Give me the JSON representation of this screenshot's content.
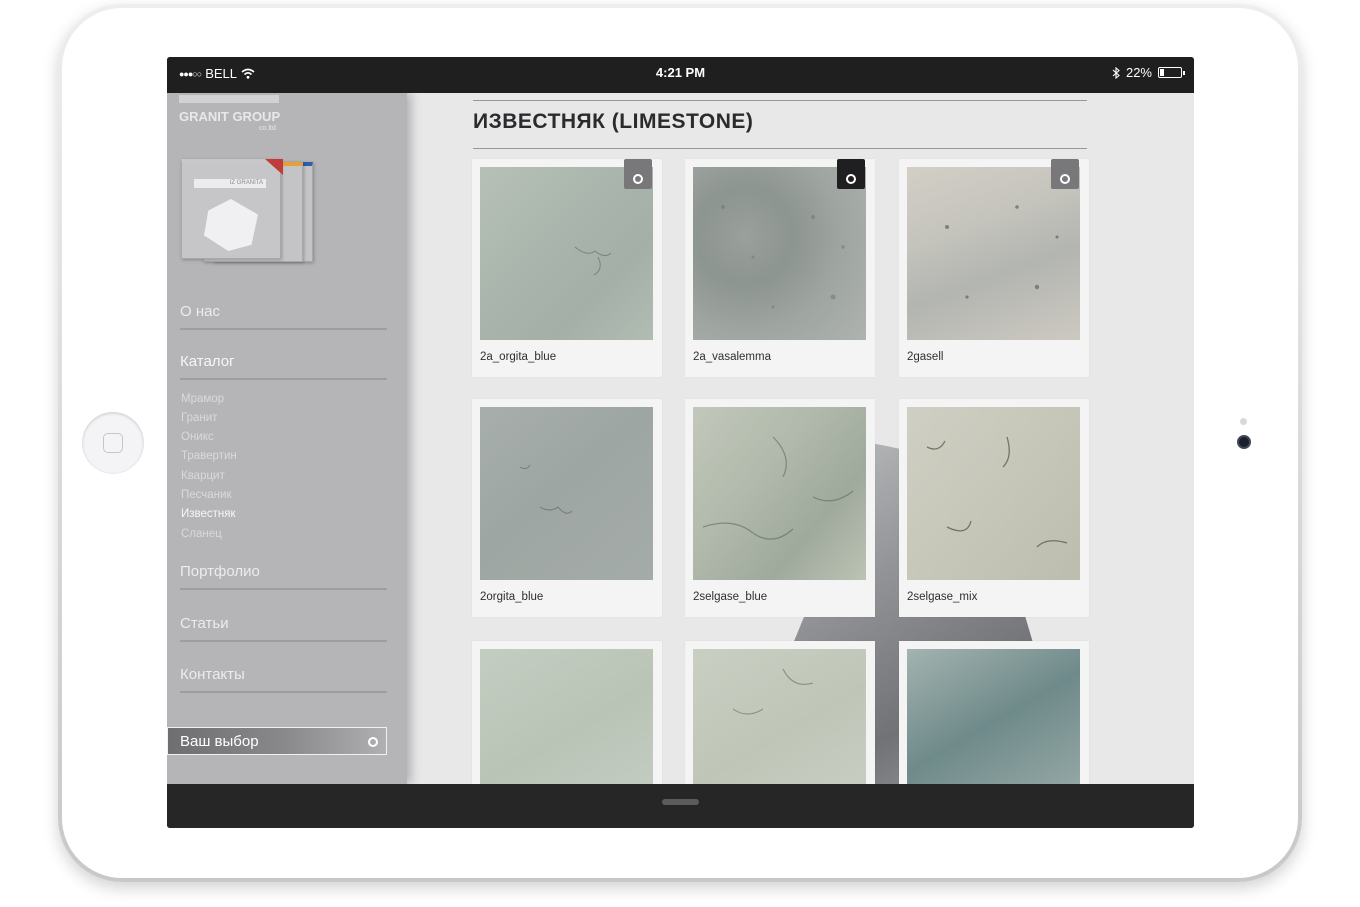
{
  "status_bar": {
    "signal": "●●●○○",
    "carrier": "BELL",
    "wifi_icon": "wifi-icon",
    "time": "4:21 PM",
    "bluetooth_icon": "bluetooth-icon",
    "battery": "22%",
    "battery_level": 0.22
  },
  "logo": {
    "name": "GRANIT GROUP",
    "suffix": "co.ltd"
  },
  "catalog_book": {
    "band_text": "IZ GRANITA"
  },
  "sidebar": {
    "nav": [
      {
        "label": "О нас"
      },
      {
        "label": "Каталог"
      },
      {
        "label": "Портфолио"
      },
      {
        "label": "Статьи"
      },
      {
        "label": "Контакты"
      }
    ],
    "sub_items": [
      {
        "label": "Мрамор"
      },
      {
        "label": "Гранит"
      },
      {
        "label": "Оникс"
      },
      {
        "label": "Травертин"
      },
      {
        "label": "Кварцит"
      },
      {
        "label": "Песчаник"
      },
      {
        "label": "Известняк"
      },
      {
        "label": "Сланец"
      }
    ],
    "choice_label": "Ваш выбор"
  },
  "page": {
    "title": "ИЗВЕСТНЯК (LIMESTONE)"
  },
  "products": [
    {
      "name": "2a_orgita_blue",
      "pick_icon": "select-circle-icon"
    },
    {
      "name": "2a_vasalemma",
      "pick_icon": "select-circle-icon"
    },
    {
      "name": "2gasell",
      "pick_icon": "select-circle-icon"
    },
    {
      "name": "2orgita_blue"
    },
    {
      "name": "2selgase_blue"
    },
    {
      "name": "2selgase_mix"
    },
    {
      "name": ""
    },
    {
      "name": ""
    },
    {
      "name": ""
    }
  ],
  "colors": {
    "sidebar_bg": "#b5b5b7",
    "content_bg": "#e8e8e9",
    "bar_bg": "#1f1f20",
    "title_text": "#2b2b2d"
  }
}
